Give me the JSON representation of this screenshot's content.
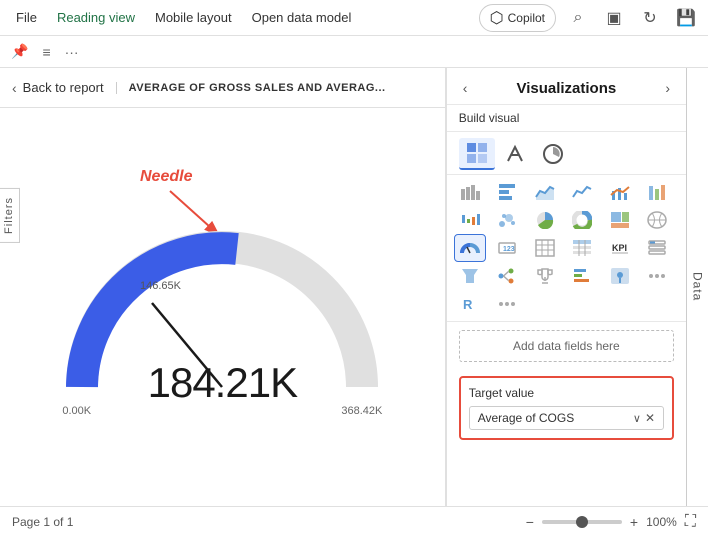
{
  "menubar": {
    "file_label": "File",
    "reading_view_label": "Reading view",
    "mobile_layout_label": "Mobile layout",
    "open_data_model_label": "Open data model",
    "copilot_label": "Copilot"
  },
  "report_header": {
    "back_label": "Back to report",
    "title": "AVERAGE OF GROSS SALES AND AVERAG..."
  },
  "chart": {
    "needle_label": "Needle",
    "value": "184.21K",
    "min": "0.00K",
    "max": "368.42K",
    "target_marker": "146.65K"
  },
  "visualizations": {
    "title": "Visualizations",
    "build_visual_label": "Build visual",
    "add_data_fields_label": "Add data fields here",
    "target_section": {
      "label": "Target value",
      "dropdown_value": "Average of COGS"
    }
  },
  "filters": {
    "label": "Filters"
  },
  "data_tab": {
    "label": "Data"
  },
  "status_bar": {
    "page_label": "Page 1 of 1",
    "zoom_label": "100%"
  }
}
